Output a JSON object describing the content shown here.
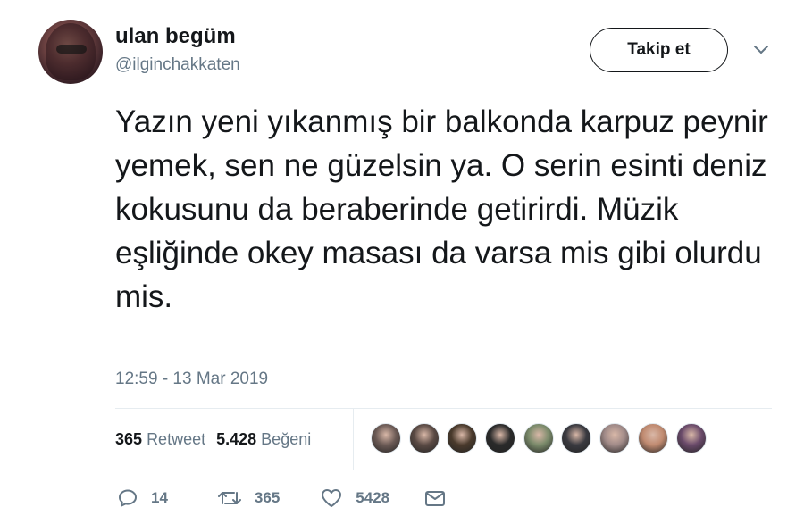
{
  "user": {
    "display_name": "ulan begüm",
    "handle": "@ilginchakkaten",
    "avatar_icon": "profile-photo"
  },
  "follow_button": {
    "label": "Takip et"
  },
  "tweet": {
    "text": "Yazın yeni yıkanmış bir balkonda karpuz peynir yemek, sen ne güzelsin ya. O serin esinti deniz kokusunu da beraberinde getirirdi. Müzik eşliğinde okey masası da varsa mis gibi olurdu mis.",
    "timestamp": "12:59 - 13 Mar 2019"
  },
  "stats": {
    "retweet_count": "365",
    "retweet_label": "Retweet",
    "like_count": "5.428",
    "like_label": "Beğeni"
  },
  "likers": {
    "avatar_colors": [
      "#6b5a55",
      "#5a4a44",
      "#4a3a2c",
      "#2a2a2a",
      "#7a8a6a",
      "#3a3a40",
      "#a08a88",
      "#c08a70",
      "#6a4a6a"
    ]
  },
  "actions": {
    "reply_count": "14",
    "retweet_count": "365",
    "like_count": "5428",
    "icons": [
      "reply-icon",
      "retweet-icon",
      "heart-icon",
      "message-icon"
    ]
  },
  "colors": {
    "text_primary": "#14171a",
    "text_secondary": "#657786",
    "divider": "#e6ecf0"
  }
}
